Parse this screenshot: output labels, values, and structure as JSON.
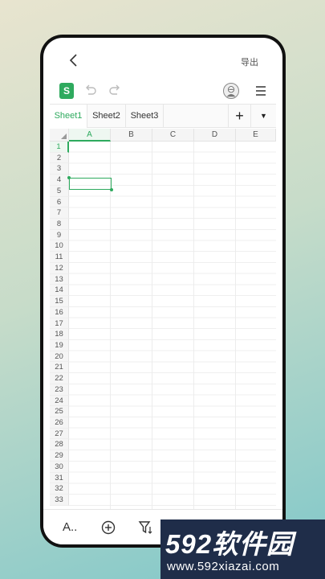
{
  "topbar": {
    "export_label": "导出"
  },
  "toolbar": {
    "app_icon_letter": "S"
  },
  "sheets": {
    "tabs": [
      {
        "label": "Sheet1",
        "active": true
      },
      {
        "label": "Sheet2",
        "active": false
      },
      {
        "label": "Sheet3",
        "active": false
      }
    ],
    "add_label": "+",
    "more_label": "▼"
  },
  "grid": {
    "columns": [
      "A",
      "B",
      "C",
      "D",
      "E"
    ],
    "rows": [
      "1",
      "2",
      "3",
      "4",
      "5",
      "6",
      "7",
      "8",
      "9",
      "10",
      "11",
      "12",
      "13",
      "14",
      "15",
      "16",
      "17",
      "18",
      "19",
      "20",
      "21",
      "22",
      "23",
      "24",
      "25",
      "26",
      "27",
      "28",
      "29",
      "30",
      "31",
      "32",
      "33"
    ],
    "selected": "A1"
  },
  "bottombar": {
    "icons": [
      "font-style-icon",
      "insert-icon",
      "filter-icon",
      "find-icon",
      "keyboard-icon",
      "collapse-icon"
    ],
    "font_label": "A.."
  },
  "colors": {
    "accent": "#2eaa5e",
    "watermark_bg": "#1f2d49"
  },
  "watermark": {
    "title": "592软件园",
    "url": "www.592xiazai.com"
  }
}
